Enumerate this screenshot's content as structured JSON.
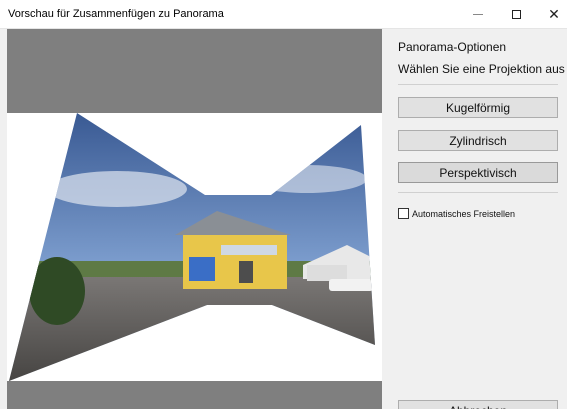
{
  "window": {
    "title": "Vorschau für Zusammenfügen zu Panorama",
    "minimize_icon": "minimize-icon",
    "maximize_icon": "maximize-icon",
    "close_icon": "close-icon"
  },
  "options": {
    "heading": "Panorama-Optionen",
    "subheading": "Wählen Sie eine Projektion aus",
    "projections": [
      {
        "label": "Kugelförmig"
      },
      {
        "label": "Zylindrisch"
      },
      {
        "label": "Perspektivisch",
        "selected": true
      }
    ],
    "auto_crop_label": "Automatisches Freistellen",
    "auto_crop_checked": false,
    "cancel_label": "Abbrechen"
  },
  "colors": {
    "sky": "#5a7fb8",
    "house_wall": "#e8c64a",
    "roof": "#8a8f95",
    "grass": "#4f6b3a",
    "pavement": "#6e6c6a"
  }
}
